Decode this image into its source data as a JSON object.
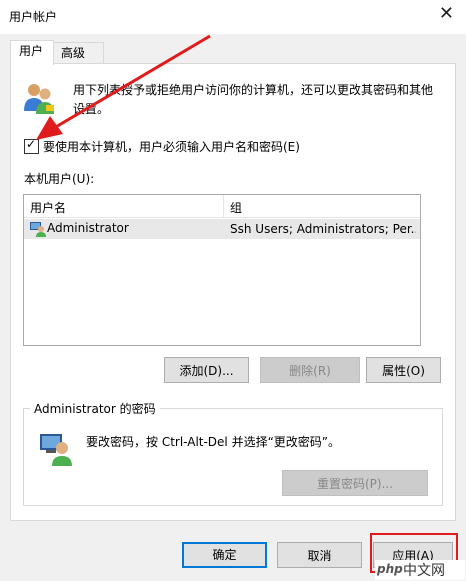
{
  "window": {
    "title": "用户帐户",
    "close_glyph": "✕"
  },
  "tabs": [
    {
      "label": "用户",
      "active": true
    },
    {
      "label": "高级",
      "active": false
    }
  ],
  "intro": {
    "text": "用下列表授予或拒绝用户访问你的计算机，还可以更改其密码和其他设置。"
  },
  "require_login": {
    "label": "要使用本计算机，用户必须输入用户名和密码(E)",
    "checked": true
  },
  "local_users": {
    "label": "本机用户(U):",
    "columns": [
      "用户名",
      "组"
    ],
    "rows": [
      {
        "name": "Administrator",
        "group": "Ssh Users; Administrators; Per..."
      }
    ]
  },
  "user_buttons": {
    "add": "添加(D)...",
    "remove": "删除(R)",
    "properties": "属性(O)"
  },
  "password_group": {
    "title": "Administrator 的密码",
    "text": "要改密码，按 Ctrl-Alt-Del 并选择“更改密码”。",
    "reset_button": "重置密码(P)..."
  },
  "footer": {
    "ok": "确定",
    "cancel": "取消",
    "apply": "应用(A)"
  },
  "watermark": {
    "php": "php",
    "cn": "中文网"
  },
  "colors": {
    "accent": "#0078d7",
    "annotation_red": "#e01b1b"
  }
}
